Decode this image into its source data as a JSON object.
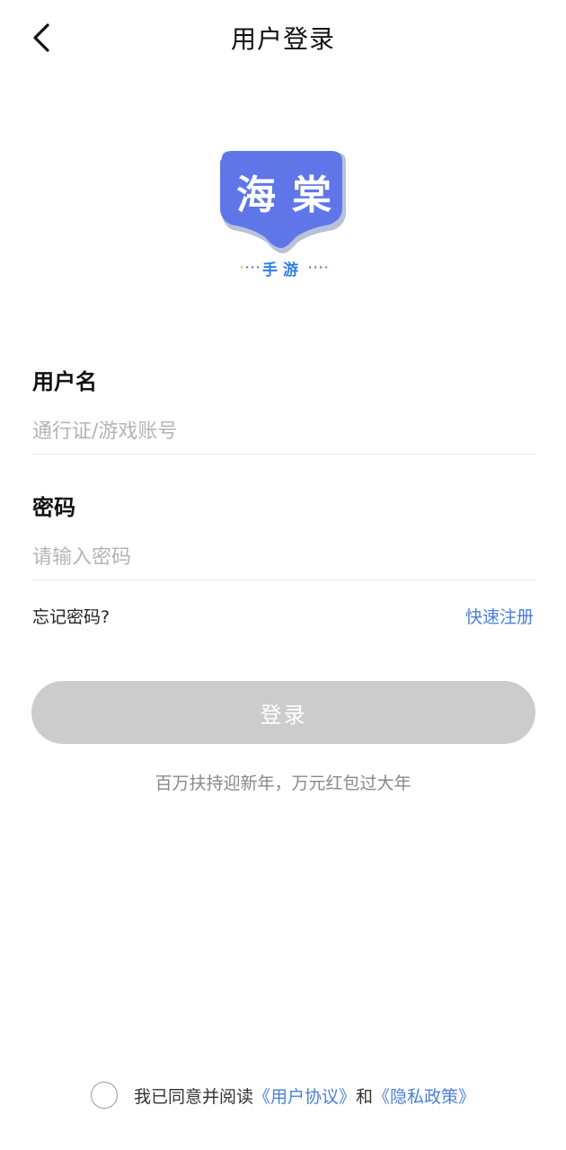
{
  "header": {
    "title": "用户登录",
    "back_icon": "chevron-left-icon"
  },
  "logo": {
    "main_char_1": "海",
    "main_char_2": "棠",
    "subtitle": "手游",
    "colors": {
      "badge": "#5e76e8",
      "badge_shadow": "#b9c1d9",
      "subtitle": "#2f7fe6"
    }
  },
  "form": {
    "username": {
      "label": "用户名",
      "placeholder": "通行证/游戏账号"
    },
    "password": {
      "label": "密码",
      "placeholder": "请输入密码"
    },
    "forgot_label": "忘记密码?",
    "register_label": "快速注册",
    "login_label": "登录"
  },
  "promo_text": "百万扶持迎新年，万元红包过大年",
  "agreement": {
    "prefix": "我已同意并阅读",
    "user_agreement": "《用户协议》",
    "conjunction": "和",
    "privacy_policy": "《隐私政策》"
  },
  "colors": {
    "link": "#4a7fd8",
    "button_disabled": "#cccccc",
    "placeholder": "#b4b4b4"
  }
}
